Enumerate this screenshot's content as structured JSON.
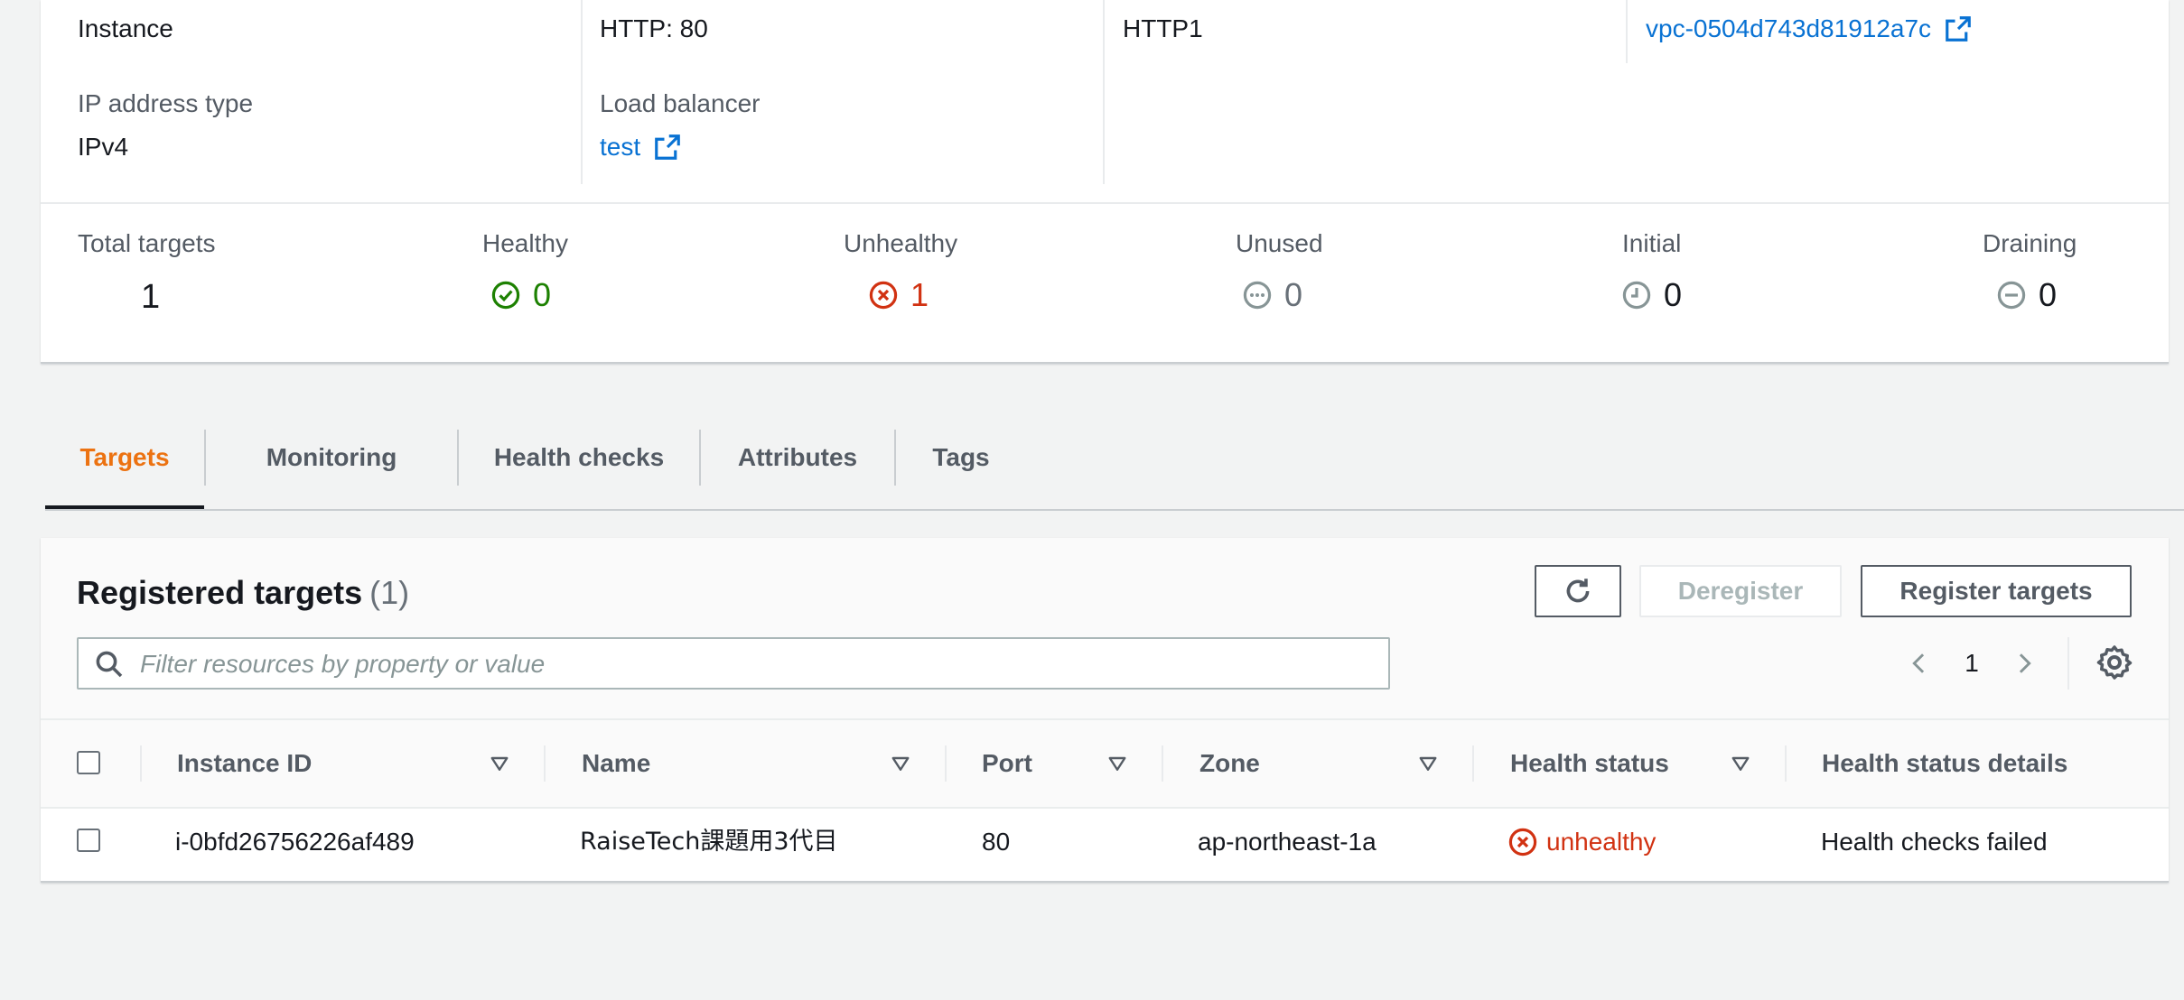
{
  "details": {
    "col1": {
      "target_type_value": "Instance",
      "ip_label": "IP address type",
      "ip_value": "IPv4"
    },
    "col2": {
      "protocol_port_value": "HTTP: 80",
      "lb_label": "Load balancer",
      "lb_value": "test"
    },
    "col3": {
      "protocol_version_value": "HTTP1"
    },
    "col4": {
      "vpc_value": "vpc-0504d743d81912a7c"
    }
  },
  "stats": {
    "total": {
      "label": "Total targets",
      "value": "1"
    },
    "healthy": {
      "label": "Healthy",
      "value": "0",
      "color": "#1d8102"
    },
    "unhealthy": {
      "label": "Unhealthy",
      "value": "1",
      "color": "#d13212"
    },
    "unused": {
      "label": "Unused",
      "value": "0",
      "color": "#687078"
    },
    "initial": {
      "label": "Initial",
      "value": "0",
      "color": "#687078"
    },
    "draining": {
      "label": "Draining",
      "value": "0",
      "color": "#687078"
    }
  },
  "tabs": [
    {
      "label": "Targets",
      "active": true
    },
    {
      "label": "Monitoring"
    },
    {
      "label": "Health checks"
    },
    {
      "label": "Attributes"
    },
    {
      "label": "Tags"
    }
  ],
  "registered": {
    "title": "Registered targets",
    "count": "(1)",
    "deregister_label": "Deregister",
    "register_label": "Register targets",
    "search_placeholder": "Filter resources by property or value",
    "page": "1"
  },
  "table": {
    "columns": [
      "Instance ID",
      "Name",
      "Port",
      "Zone",
      "Health status",
      "Health status details"
    ],
    "rows": [
      {
        "instance_id": "i-0bfd26756226af489",
        "name": "RaiseTech課題用3代目",
        "port": "80",
        "zone": "ap-northeast-1a",
        "health_status": "unhealthy",
        "health_status_details": "Health checks failed"
      }
    ]
  },
  "colors": {
    "link": "#0972d3",
    "accent": "#ec7211",
    "error": "#d13212",
    "success": "#1d8102"
  }
}
